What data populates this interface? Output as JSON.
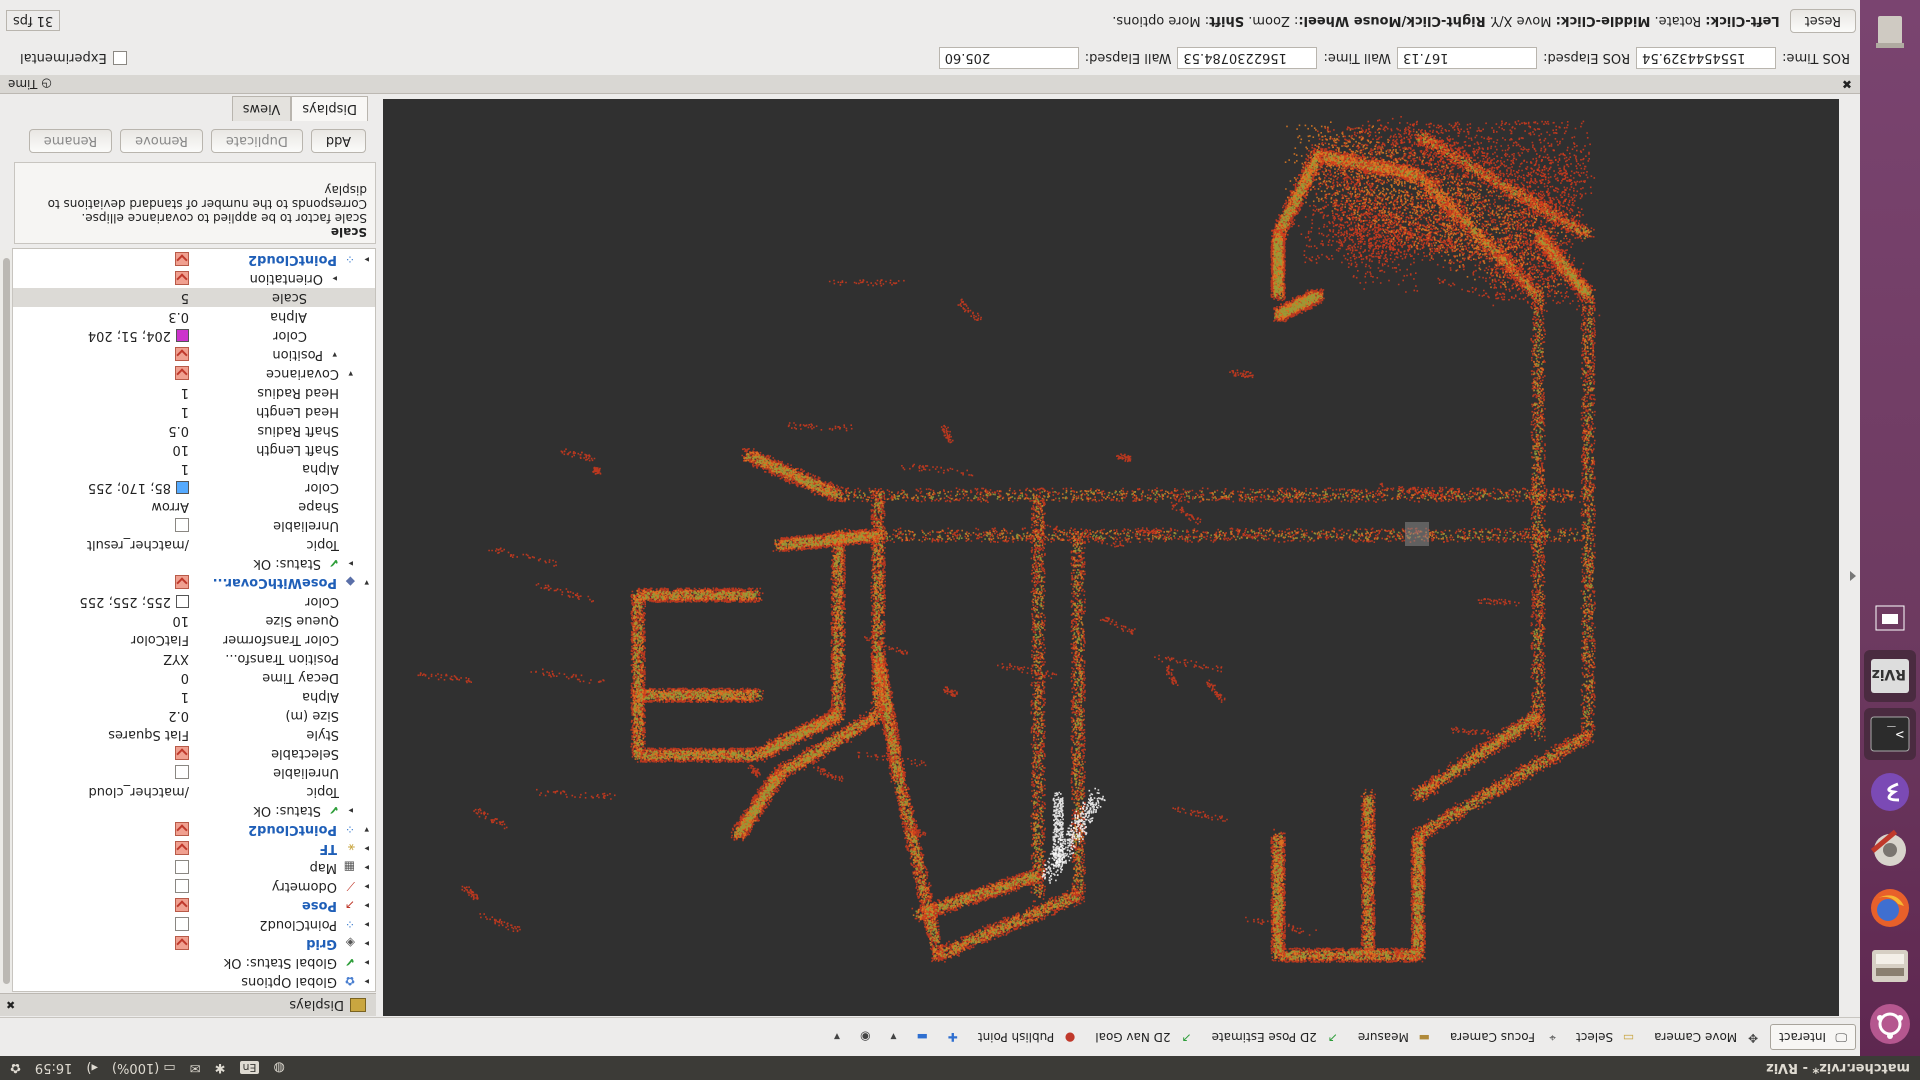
{
  "system_bar": {
    "window_title": "matcher.rviz* - RViz",
    "keyboard": "En",
    "battery": "(100%)",
    "clock": "16:59"
  },
  "toolbar": {
    "tools": [
      {
        "label": "Interact",
        "icon": "interact-icon"
      },
      {
        "label": "Move Camera",
        "icon": "move-camera-icon"
      },
      {
        "label": "Select",
        "icon": "select-icon"
      },
      {
        "label": "Focus Camera",
        "icon": "focus-camera-icon"
      },
      {
        "label": "Measure",
        "icon": "measure-icon"
      },
      {
        "label": "2D Pose Estimate",
        "icon": "pose-estimate-icon"
      },
      {
        "label": "2D Nav Goal",
        "icon": "nav-goal-icon"
      },
      {
        "label": "Publish Point",
        "icon": "publish-point-icon"
      }
    ]
  },
  "displays": {
    "panel_title": "Displays",
    "tree": [
      {
        "name": "Global Options",
        "indent": 0,
        "expander": "▸",
        "icon": "global-options-icon"
      },
      {
        "name": "Global Status: Ok",
        "indent": 0,
        "expander": "▸",
        "icon": "check-icon"
      },
      {
        "name": "Grid",
        "indent": 0,
        "expander": "▸",
        "icon": "grid-icon",
        "checked": true,
        "blue": true
      },
      {
        "name": "PointCloud2",
        "indent": 0,
        "expander": "▸",
        "icon": "pointcloud-icon",
        "checked": false
      },
      {
        "name": "Pose",
        "indent": 0,
        "expander": "▸",
        "icon": "pose-icon",
        "checked": true,
        "blue": true
      },
      {
        "name": "Odometry",
        "indent": 0,
        "expander": "▸",
        "icon": "odometry-icon",
        "checked": false
      },
      {
        "name": "Map",
        "indent": 0,
        "expander": "▸",
        "icon": "map-icon",
        "checked": false
      },
      {
        "name": "TF",
        "indent": 0,
        "expander": "▸",
        "icon": "tf-icon",
        "checked": true,
        "blue": true
      },
      {
        "name": "PointCloud2",
        "indent": 0,
        "expander": "▾",
        "icon": "pointcloud-icon",
        "checked": true,
        "blue": true
      },
      {
        "name": "Status: Ok",
        "indent": 1,
        "expander": "▸",
        "icon": "check-icon"
      },
      {
        "name": "Topic",
        "indent": 1,
        "value": "/matcher_cloud"
      },
      {
        "name": "Unreliable",
        "indent": 1,
        "checked": false
      },
      {
        "name": "Selectable",
        "indent": 1,
        "checked": true
      },
      {
        "name": "Style",
        "indent": 1,
        "value": "Flat Squares"
      },
      {
        "name": "Size (m)",
        "indent": 1,
        "value": "0.2"
      },
      {
        "name": "Alpha",
        "indent": 1,
        "value": "1"
      },
      {
        "name": "Decay Time",
        "indent": 1,
        "value": "0"
      },
      {
        "name": "Position Transfo...",
        "indent": 1,
        "value": "XYZ"
      },
      {
        "name": "Color Transformer",
        "indent": 1,
        "value": "FlatColor"
      },
      {
        "name": "Queue Size",
        "indent": 1,
        "value": "10"
      },
      {
        "name": "Color",
        "indent": 1,
        "value": "255; 255; 255",
        "swatch": "#ffffff"
      },
      {
        "name": "PoseWithCovar...",
        "indent": 0,
        "expander": "▾",
        "icon": "pose-covariance-icon",
        "checked": true,
        "blue": true
      },
      {
        "name": "Status: Ok",
        "indent": 1,
        "expander": "▸",
        "icon": "check-icon"
      },
      {
        "name": "Topic",
        "indent": 1,
        "value": "/matcher_result"
      },
      {
        "name": "Unreliable",
        "indent": 1,
        "checked": false
      },
      {
        "name": "Shape",
        "indent": 1,
        "value": "Arrow"
      },
      {
        "name": "Color",
        "indent": 1,
        "value": "85; 170; 255",
        "swatch": "#55aaff"
      },
      {
        "name": "Alpha",
        "indent": 1,
        "value": "1"
      },
      {
        "name": "Shaft Length",
        "indent": 1,
        "value": "10"
      },
      {
        "name": "Shaft Radius",
        "indent": 1,
        "value": "0.5"
      },
      {
        "name": "Head Length",
        "indent": 1,
        "value": "1"
      },
      {
        "name": "Head Radius",
        "indent": 1,
        "value": "1"
      },
      {
        "name": "Covariance",
        "indent": 1,
        "expander": "▾",
        "checked": true
      },
      {
        "name": "Position",
        "indent": 2,
        "expander": "▾",
        "checked": true
      },
      {
        "name": "Color",
        "indent": 3,
        "value": "204; 51; 204",
        "swatch": "#cc33cc"
      },
      {
        "name": "Alpha",
        "indent": 3,
        "value": "0.3"
      },
      {
        "name": "Scale",
        "indent": 3,
        "value": "5",
        "selected": true
      },
      {
        "name": "Orientation",
        "indent": 2,
        "expander": "▸",
        "checked": true
      },
      {
        "name": "PointCloud2",
        "indent": 0,
        "expander": "▸",
        "icon": "pointcloud-icon",
        "checked": true,
        "blue": true
      }
    ],
    "description": {
      "title": "Scale",
      "text": "Scale factor to be applied to covariance ellipse. Corresponds to the number of standard deviations to display"
    },
    "buttons": [
      "Add",
      "Duplicate",
      "Remove",
      "Rename"
    ],
    "tabs": [
      "Displays",
      "Views"
    ]
  },
  "time_panel": {
    "title": "Time",
    "ros_time_label": "ROS Time:",
    "ros_time": "1554544329.54",
    "ros_elapsed_label": "ROS Elapsed:",
    "ros_elapsed": "167.13",
    "wall_time_label": "Wall Time:",
    "wall_time": "1562230784.53",
    "wall_elapsed_label": "Wall Elapsed:",
    "wall_elapsed": "205.60",
    "experimental_label": "Experimental"
  },
  "status_bar": {
    "reset_label": "Reset",
    "hint_parts": [
      {
        "text": "Left-Click:",
        "bold": true
      },
      {
        "text": " Rotate. ",
        "bold": false
      },
      {
        "text": "Middle-Click:",
        "bold": true
      },
      {
        "text": " Move X/Y. ",
        "bold": false
      },
      {
        "text": "Right-Click/Mouse Wheel:",
        "bold": true
      },
      {
        "text": ": Zoom. ",
        "bold": false
      },
      {
        "text": "Shift",
        "bold": true
      },
      {
        "text": ": More options.",
        "bold": false
      }
    ],
    "fps": "31 fps"
  },
  "colors": {
    "background": "#303030",
    "point_red": "#d23a1c",
    "point_orange": "#e07a22",
    "point_green": "#8fa03a",
    "point_white": "#ffffff",
    "launcher": "#6d3a60"
  }
}
